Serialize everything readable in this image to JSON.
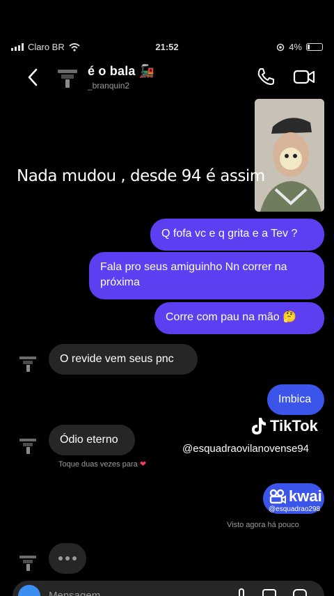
{
  "status_bar": {
    "carrier": "Claro BR",
    "time": "21:52",
    "battery": "4%"
  },
  "header": {
    "title": "é o bala 🚂",
    "username": "_branquin2"
  },
  "video_caption": "Nada mudou , desde 94 é assim",
  "messages": [
    {
      "side": "out",
      "text": "Q fofa vc e q grita e a Tev ?"
    },
    {
      "side": "out",
      "text": "Fala pro seus amiguinho Nn correr na próxima"
    },
    {
      "side": "out",
      "text": "Corre com pau na mão 🤔"
    },
    {
      "side": "in",
      "text": "O revide vem seus pnc"
    },
    {
      "side": "out",
      "text": "Imbica"
    },
    {
      "side": "in",
      "text": "Ódio eterno"
    },
    {
      "side": "out",
      "text": ""
    }
  ],
  "reaction_hint": "Toque duas vezes para",
  "seen_status": "Visto agora há pouco",
  "watermarks": {
    "tiktok_brand": "TikTok",
    "tiktok_user": "@esquadraovilanovense94",
    "kwai_brand": "kwai",
    "kwai_user": "@esquadrao298"
  },
  "composer": {
    "placeholder": "Mensagem..."
  },
  "colors": {
    "outgoing_bubble": "#5b3ff0",
    "incoming_bubble": "#262626",
    "background": "#000000"
  }
}
